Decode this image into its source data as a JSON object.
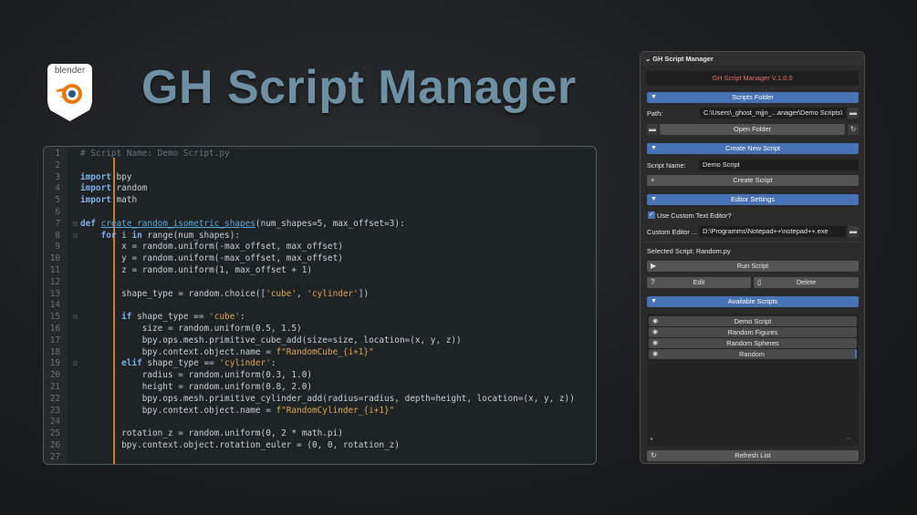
{
  "logo": {
    "text": "blender"
  },
  "title": "GH Script Manager",
  "editor": {
    "lines": [
      {
        "n": "1",
        "html": "<span class='cm'># Script Name: Demo Script.py</span>"
      },
      {
        "n": "2",
        "html": ""
      },
      {
        "n": "3",
        "html": "<span class='kw'>import</span> bpy"
      },
      {
        "n": "4",
        "html": "<span class='kw'>import</span> random"
      },
      {
        "n": "5",
        "html": "<span class='kw'>import</span> math"
      },
      {
        "n": "6",
        "html": ""
      },
      {
        "n": "7",
        "html": "<span class='kw'>def</span> <span class='fn'>create_random_isometric_shapes</span>(num_shapes=5, max_offset=3):"
      },
      {
        "n": "8",
        "html": "    <span class='kw'>for</span> i <span class='kw'>in</span> range(num_shapes):"
      },
      {
        "n": "9",
        "html": "        x = random.uniform(-max_offset, max_offset)"
      },
      {
        "n": "10",
        "html": "        y = random.uniform(-max_offset, max_offset)"
      },
      {
        "n": "11",
        "html": "        z = random.uniform(1, max_offset + 1)"
      },
      {
        "n": "12",
        "html": ""
      },
      {
        "n": "13",
        "html": "        shape_type = random.choice([<span class='str'>'cube'</span>, <span class='str'>'cylinder'</span>])"
      },
      {
        "n": "14",
        "html": ""
      },
      {
        "n": "15",
        "html": "        <span class='kw'>if</span> shape_type == <span class='str'>'cube'</span>:"
      },
      {
        "n": "16",
        "html": "            size = random.uniform(0.5, 1.5)"
      },
      {
        "n": "17",
        "html": "            bpy.ops.mesh.primitive_cube_add(size=size, location=(x, y, z))"
      },
      {
        "n": "18",
        "html": "            bpy.context.object.name = <span class='str'>f\"RandomCube_{i+1}\"</span>"
      },
      {
        "n": "19",
        "html": "        <span class='kw'>elif</span> shape_type == <span class='str'>'cylinder'</span>:"
      },
      {
        "n": "20",
        "html": "            radius = random.uniform(0.3, 1.0)"
      },
      {
        "n": "21",
        "html": "            height = random.uniform(0.8, 2.0)"
      },
      {
        "n": "22",
        "html": "            bpy.ops.mesh.primitive_cylinder_add(radius=radius, depth=height, location=(x, y, z))"
      },
      {
        "n": "23",
        "html": "            bpy.context.object.name = <span class='str'>f\"RandomCylinder_{i+1}\"</span>"
      },
      {
        "n": "24",
        "html": ""
      },
      {
        "n": "25",
        "html": "        rotation_z = random.uniform(0, 2 * math.pi)"
      },
      {
        "n": "26",
        "html": "        bpy.context.object.rotation_euler = (0, 0, rotation_z)"
      },
      {
        "n": "27",
        "html": ""
      }
    ]
  },
  "panel": {
    "header": "GH Script Manager",
    "version": "GH Script Manager V.1.0.0",
    "scripts_folder": {
      "section": "Scripts Folder",
      "path_label": "Path:",
      "path_value": "C:\\Users\\_ghost_mjjn_...anager\\Demo Scripts\\",
      "open_folder": "Open Folder"
    },
    "create": {
      "section": "Create New Script",
      "name_label": "Script Name:",
      "name_value": "Demo Script",
      "create_button": "Create Script"
    },
    "editor_settings": {
      "section": "Editor Settings",
      "use_custom": "Use Custom Text Editor?",
      "custom_label": "Custom Editor ...",
      "custom_value": "D:\\Programms\\Notepad++\\notepad++.exe"
    },
    "selected": {
      "label": "Selected Script: Random.py",
      "run": "Run Script",
      "edit": "Edit",
      "delete": "Delete"
    },
    "available": {
      "section": "Available Scripts",
      "items": [
        "Demo Script",
        "Random Figures",
        "Random Spheres",
        "Random"
      ],
      "selected_index": 3
    },
    "refresh": "Refresh List"
  }
}
